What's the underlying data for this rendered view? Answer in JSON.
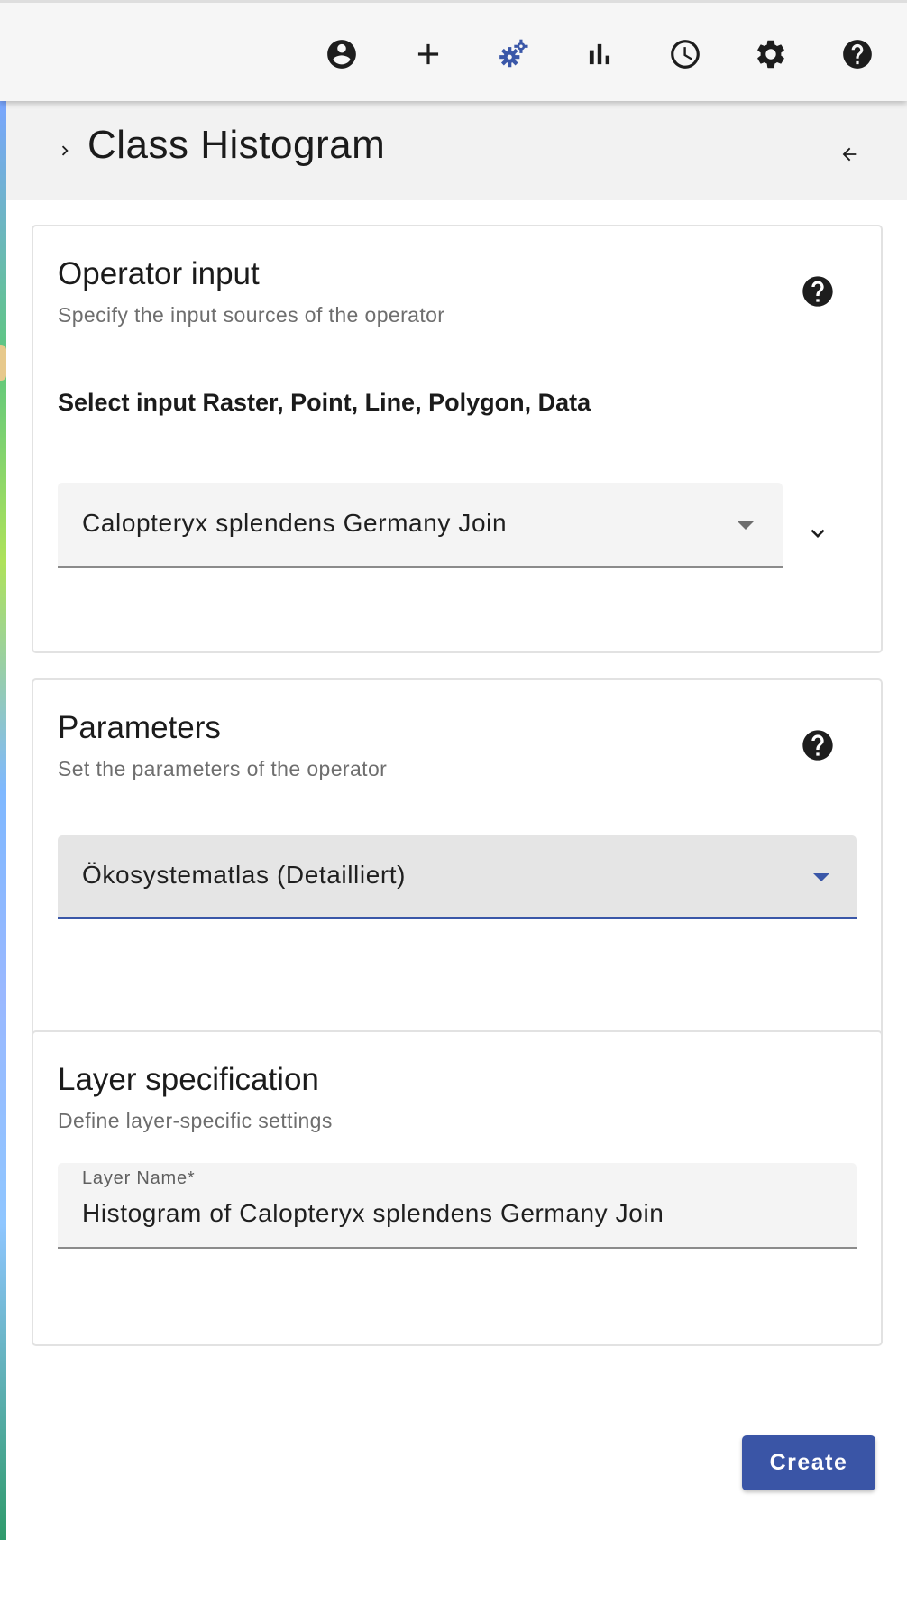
{
  "toolbar": {
    "icons": [
      {
        "name": "account-icon"
      },
      {
        "name": "add-icon"
      },
      {
        "name": "operators-icon",
        "active": true
      },
      {
        "name": "plots-icon"
      },
      {
        "name": "time-icon"
      },
      {
        "name": "settings-icon"
      },
      {
        "name": "help-icon"
      }
    ],
    "accent_color": "#3a57a8"
  },
  "panel": {
    "title": "Class Histogram",
    "operator_input": {
      "title": "Operator input",
      "subtitle": "Specify the input sources of the operator",
      "select_label": "Select input Raster, Point, Line, Polygon, Data",
      "selected_value": "Calopteryx splendens Germany Join"
    },
    "parameters": {
      "title": "Parameters",
      "subtitle": "Set the parameters of the operator",
      "selected_value": "Ökosystematlas (Detailliert)"
    },
    "layer_specification": {
      "title": "Layer specification",
      "subtitle": "Define layer-specific settings",
      "layer_name_label": "Layer Name*",
      "layer_name_value": "Histogram of Calopteryx splendens Germany Join"
    },
    "create_label": "Create"
  }
}
